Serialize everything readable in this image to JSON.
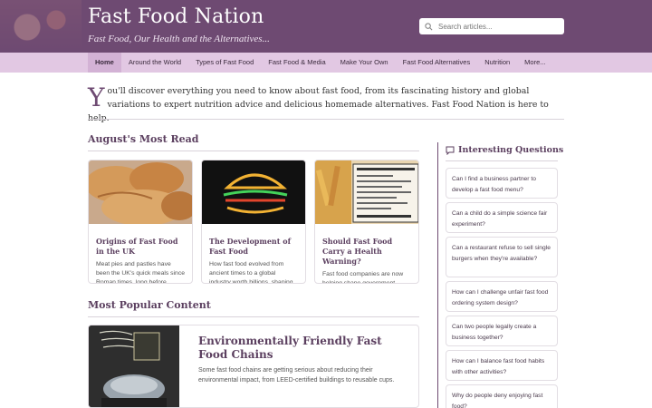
{
  "header": {
    "title": "Fast Food Nation",
    "tagline": "Fast Food, Our Health and the Alternatives...",
    "search_placeholder": "Search articles..."
  },
  "nav": {
    "items": [
      {
        "label": "Home",
        "active": true
      },
      {
        "label": "Around the World"
      },
      {
        "label": "Types of Fast Food"
      },
      {
        "label": "Fast Food & Media"
      },
      {
        "label": "Make Your Own"
      },
      {
        "label": "Fast Food Alternatives"
      },
      {
        "label": "Nutrition"
      },
      {
        "label": "More..."
      }
    ]
  },
  "intro": {
    "dropcap": "Y",
    "text": "ou'll discover everything you need to know about fast food, from its fascinating history and global variations to expert nutrition advice and delicious homemade alternatives. Fast Food Nation is here to help."
  },
  "most_read": {
    "heading": "August's Most Read",
    "cards": [
      {
        "title": "Origins of Fast Food in the UK",
        "text": "Meat pies and pastles have been the UK's quick meals since Roman times, long before burge..."
      },
      {
        "title": "The Development of Fast Food",
        "text": "How fast food evolved from ancient times to a global industry worth billions, shaping modern..."
      },
      {
        "title": "Should Fast Food Carry a Health Warning?",
        "text": "Fast food companies are now helping shape government policy on health warnings, after studie..."
      }
    ]
  },
  "popular": {
    "heading": "Most Popular Content",
    "feature": {
      "title": "Environmentally Friendly Fast Food Chains",
      "text": "Some fast food chains are getting serious about reducing their environmental impact, from LEED-certified buildings to reusable cups."
    }
  },
  "sidebar": {
    "heading": "Interesting Questions",
    "questions": [
      "Can I find a business partner to develop a fast food menu?",
      "Can a child do a simple science fair experiment?",
      "Can a restaurant refuse to sell single burgers when they're available?",
      "How can I challenge unfair fast food ordering system design?",
      "Can two people legally create a business together?",
      "How can I balance fast food habits with other activities?",
      "Why do people deny enjoying fast food?"
    ]
  },
  "colors": {
    "brand": "#6e4a72",
    "nav_bg": "#e2c8e3",
    "heading": "#5b3f5f"
  }
}
